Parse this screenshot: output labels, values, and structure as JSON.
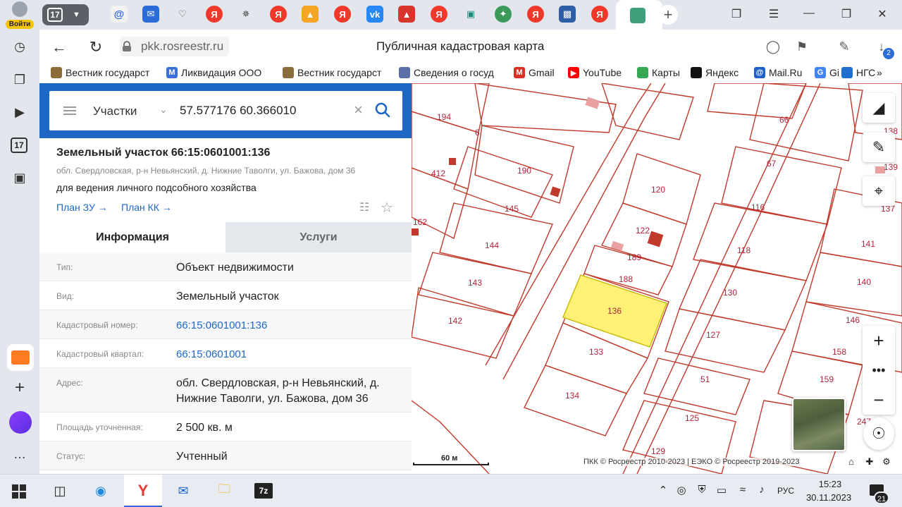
{
  "sidebar": {
    "login_label": "Войти",
    "counter_label": "17"
  },
  "tabstrip": {
    "tab_count": "17",
    "yandex_letter": "Я"
  },
  "addressbar": {
    "url": "pkk.rosreestr.ru",
    "page_title": "Публичная кадастровая карта",
    "downloads_count": "2"
  },
  "bookmarks": [
    {
      "label": "Вестник государст",
      "icon": "eagle-icon",
      "color": "#8a6d3b"
    },
    {
      "label": "Ликвидация ООО",
      "icon": "m-logo-icon",
      "color": "#3b6fd8",
      "letter": "M"
    },
    {
      "label": "Вестник государст",
      "icon": "eagle-icon",
      "color": "#8a6d3b"
    },
    {
      "label": "Сведения о госуд",
      "icon": "emblem-icon",
      "color": "#5b6fa8"
    },
    {
      "label": "Gmail",
      "icon": "gmail-icon",
      "color": "#d93025",
      "letter": "M"
    },
    {
      "label": "YouTube",
      "icon": "youtube-icon",
      "color": "#ff0000",
      "letter": "▶"
    },
    {
      "label": "Карты",
      "icon": "maps-pin-icon",
      "color": "#34a853"
    },
    {
      "label": "Яндекс",
      "icon": "yandex-icon",
      "color": "#111111"
    },
    {
      "label": "Mail.Ru",
      "icon": "mailru-icon",
      "color": "#1f5fcc",
      "letter": "@"
    },
    {
      "label": "Gi",
      "icon": "google-icon",
      "color": "#4285f4",
      "letter": "G"
    },
    {
      "label": "НГС",
      "icon": "ngs-icon",
      "color": "#1f6fd0"
    }
  ],
  "search": {
    "type": "Участки",
    "query": "57.577176 60.366010"
  },
  "parcel": {
    "title": "Земельный участок 66:15:0601001:136",
    "address": "обл. Свердловская, р-н Невьянский, д. Нижние Таволги, ул. Бажова, дом 36",
    "use": "для ведения личного подсобного хозяйства",
    "plan_zu": "План ЗУ →",
    "plan_kk": "План КК →"
  },
  "tabs": {
    "info": "Информация",
    "services": "Услуги"
  },
  "info_rows": [
    {
      "key": "Тип:",
      "value": "Объект недвижимости",
      "link": false
    },
    {
      "key": "Вид:",
      "value": "Земельный участок",
      "link": false
    },
    {
      "key": "Кадастровый номер:",
      "value": "66:15:0601001:136",
      "link": true
    },
    {
      "key": "Кадастровый квартал:",
      "value": "66:15:0601001",
      "link": true
    },
    {
      "key": "Адрес:",
      "value": "обл. Свердловская, р-н Невьянский, д. Нижние Таволги, ул. Бажова, дом 36",
      "link": false
    },
    {
      "key": "Площадь уточненная:",
      "value": "2 500 кв. м",
      "link": false
    },
    {
      "key": "Статус:",
      "value": "Учтенный",
      "link": false
    }
  ],
  "map": {
    "labels": [
      "194",
      "6",
      "412",
      "190",
      "145",
      "162",
      "144",
      "143",
      "142",
      "120",
      "122",
      "189",
      "188",
      "136",
      "133",
      "134",
      "66",
      "67",
      "116",
      "118",
      "130",
      "127",
      "51",
      "125",
      "129",
      "138",
      "139",
      "137",
      "141",
      "140",
      "146",
      "158",
      "159",
      "247"
    ],
    "scale": "60 м",
    "copyright": "ПКК © Росреестр 2010-2023 | ЕЭКО © Росреестр 2019-2023",
    "highlight_color": "#fff176",
    "parcel_line_color": "#c0392b"
  },
  "taskbar": {
    "lang": "РУС",
    "time": "15:23",
    "date": "30.11.2023",
    "notifications": "21"
  }
}
